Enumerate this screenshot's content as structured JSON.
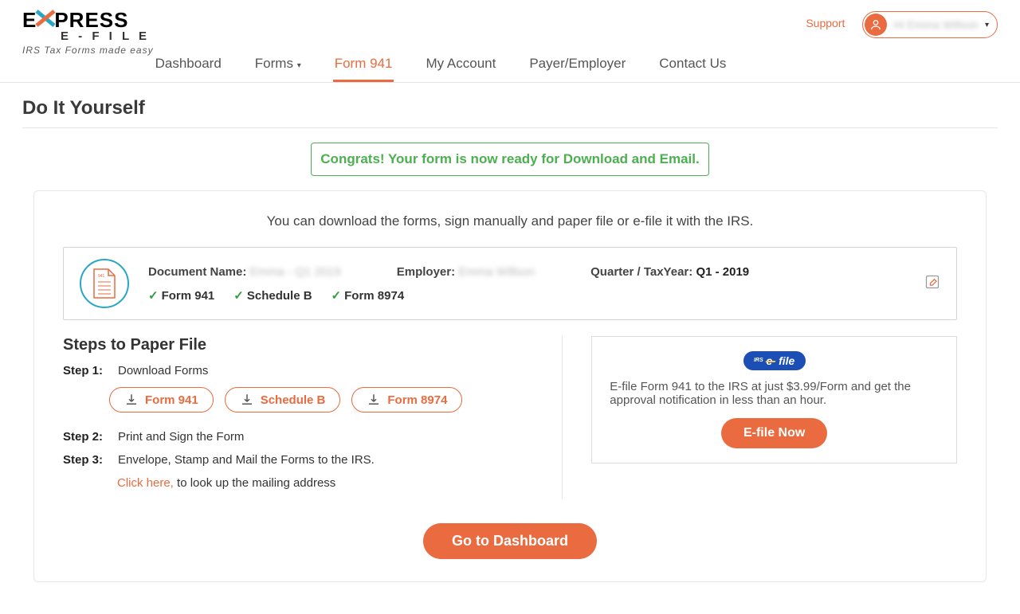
{
  "header": {
    "logo_main": "EXPRESS",
    "logo_sub": "E - F I L E",
    "tagline": "IRS Tax Forms made easy",
    "support": "Support",
    "user_name": "Hi Emma Willson"
  },
  "nav": {
    "dashboard": "Dashboard",
    "forms": "Forms",
    "form941": "Form 941",
    "account": "My Account",
    "payer": "Payer/Employer",
    "contact": "Contact Us"
  },
  "page": {
    "title": "Do It Yourself",
    "congrats": "Congrats! Your form is now ready for Download and Email.",
    "lead": "You can download the forms, sign manually and paper file or e-file it with the IRS."
  },
  "doc": {
    "name_label": "Document Name:",
    "name_value": "Emma - Q1 2019",
    "employer_label": "Employer:",
    "employer_value": "Emma Willson",
    "quarter_label": "Quarter / TaxYear:",
    "quarter_value": "Q1 - 2019",
    "form941": "Form 941",
    "scheduleB": "Schedule B",
    "form8974": "Form 8974"
  },
  "steps": {
    "title": "Steps to Paper File",
    "s1_label": "Step 1:",
    "s1_text": "Download Forms",
    "s2_label": "Step 2:",
    "s2_text": "Print and Sign the Form",
    "s3_label": "Step 3:",
    "s3_text": "Envelope, Stamp and Mail the Forms to the IRS.",
    "click_here": "Click here,",
    "mailing": " to look up the mailing address",
    "dl_form941": "Form 941",
    "dl_scheduleB": "Schedule B",
    "dl_form8974": "Form 8974"
  },
  "efile": {
    "logo_text": "IRS e file",
    "text": "E-file Form 941 to the IRS at just $3.99/Form and get the approval notification in less than an hour.",
    "button": "E-file Now"
  },
  "dashboard_btn": "Go to Dashboard"
}
